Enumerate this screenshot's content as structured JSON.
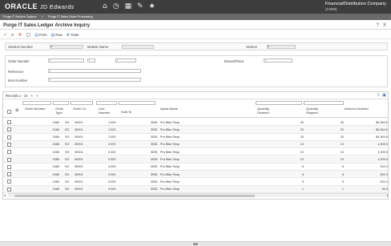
{
  "app": {
    "logo_oracle": "ORACLE",
    "logo_product": "JD Edwards",
    "environment_company": "Financial/Distribution Company",
    "environment_code": "(JV900)"
  },
  "nav_icons": [
    "home-icon",
    "clock-icon",
    "grid-icon",
    "edit-icon",
    "star-icon"
  ],
  "breadcrumb": {
    "items": [
      "Purge IT Archive System",
      ">",
      "Purge IT Sales Order Processing"
    ]
  },
  "form": {
    "title": "Purge IT Sales Ledger Archive Inquiry",
    "help": "?",
    "close": "X"
  },
  "toolbar": {
    "select": "Select",
    "find": "Find",
    "close": "Close",
    "items": [
      "Form",
      "Row",
      "Tools"
    ]
  },
  "header": {
    "session_number_label": "Session Number",
    "module_name_label": "Module Name",
    "version_label": "Version",
    "session_number_value": "*",
    "module_name_value": "",
    "version_value": "*"
  },
  "filters": {
    "order_number_label": "Order Number",
    "branch_plant_label": "Branch/Plant",
    "reference_label": "Reference",
    "item_number_label": "Item Number",
    "order_number_value": "*",
    "order_type_value": "*",
    "order_co_value": "*",
    "branch_plant_value": "*",
    "reference_value": "*",
    "item_number_value": "*"
  },
  "grid": {
    "records_label": "Records 1 - 10",
    "nav_prev": "<",
    "nav_next": ">",
    "columns": [
      "Order Number",
      "Order Type",
      "Order Co",
      "Line Number",
      "Sold To",
      "Alpha Name",
      "Quantity Ordered",
      "Quantity Shipped",
      "Amount Ordered"
    ],
    "rows": [
      {
        "order": "2465",
        "type": "SO",
        "co": "00001",
        "line": "1.000",
        "sold_to": "3535",
        "name": "Pro Bike Shop",
        "qty_ord": "20",
        "qty_ship": "20",
        "amount": "$4,364.60"
      },
      {
        "order": "2465",
        "type": "SO",
        "co": "00001",
        "line": "1.000",
        "sold_to": "3535",
        "name": "Pro Bike Shop",
        "qty_ord": "20",
        "qty_ship": "20",
        "amount": "$4,364.60"
      },
      {
        "order": "2465",
        "type": "SO",
        "co": "00001",
        "line": "1.000",
        "sold_to": "3535",
        "name": "Pro Bike Shop",
        "qty_ord": "20",
        "qty_ship": "20",
        "amount": "$4,364.60"
      },
      {
        "order": "2465",
        "type": "SO",
        "co": "00001",
        "line": "2.000",
        "sold_to": "3535",
        "name": "Pro Bike Shop",
        "qty_ord": "10",
        "qty_ship": "10",
        "amount": "1,305.00"
      },
      {
        "order": "2465",
        "type": "SO",
        "co": "00001",
        "line": "2.000",
        "sold_to": "3535",
        "name": "Pro Bike Shop",
        "qty_ord": "10",
        "qty_ship": "10",
        "amount": "1,305.00"
      },
      {
        "order": "2465",
        "type": "SO",
        "co": "00001",
        "line": "2.000",
        "sold_to": "3535",
        "name": "Pro Bike Shop",
        "qty_ord": "10",
        "qty_ship": "10",
        "amount": "1,305.00"
      },
      {
        "order": "2465",
        "type": "SO",
        "co": "00001",
        "line": "3.000",
        "sold_to": "3535",
        "name": "Pro Bike Shop",
        "qty_ord": "5",
        "qty_ship": "5",
        "amount": "302.40"
      },
      {
        "order": "2465",
        "type": "SO",
        "co": "00001",
        "line": "3.000",
        "sold_to": "3535",
        "name": "Pro Bike Shop",
        "qty_ord": "5",
        "qty_ship": "5",
        "amount": "302.40"
      },
      {
        "order": "2465",
        "type": "SO",
        "co": "00001",
        "line": "3.000",
        "sold_to": "3535",
        "name": "Pro Bike Shop",
        "qty_ord": "5",
        "qty_ship": "5",
        "amount": "302.40"
      },
      {
        "order": "2465",
        "type": "SO",
        "co": "00001",
        "line": "4.000",
        "sold_to": "3535",
        "name": "Pro Bike Shop",
        "qty_ord": "1",
        "qty_ship": "1",
        "amount": "96.00"
      }
    ]
  },
  "colors": {
    "topbar": "#3d3d3d",
    "breadcrumb": "#6a6a6a",
    "select_check": "#3a8a2a",
    "close_x": "#c0392b",
    "link": "#4a6fa5"
  }
}
